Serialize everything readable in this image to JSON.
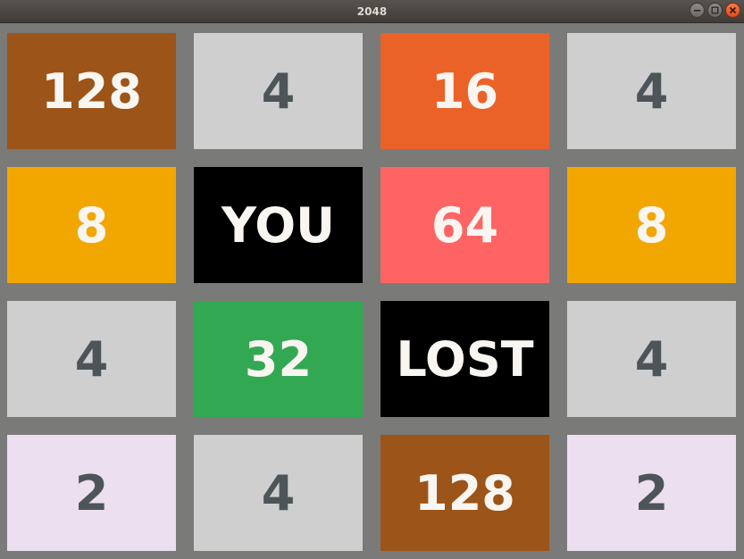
{
  "window": {
    "title": "2048",
    "controls": [
      "minimize-icon",
      "maximize-icon",
      "close-icon"
    ]
  },
  "colors": {
    "background": "#7a7a78",
    "dark_text": "#4d5558",
    "light_text": "#f9f6f2",
    "t2": "#ebdff0",
    "t4": "#cfcfcf",
    "t8": "#f2a700",
    "t16": "#eb6228",
    "t32": "#33a852",
    "t64": "#ff6464",
    "t128": "#9c5418",
    "message": "#000000"
  },
  "board": {
    "rows": [
      [
        {
          "label": "128",
          "kind": "t128"
        },
        {
          "label": "4",
          "kind": "t4"
        },
        {
          "label": "16",
          "kind": "t16"
        },
        {
          "label": "4",
          "kind": "t4"
        }
      ],
      [
        {
          "label": "8",
          "kind": "t8"
        },
        {
          "label": "YOU",
          "kind": "message"
        },
        {
          "label": "64",
          "kind": "t64"
        },
        {
          "label": "8",
          "kind": "t8"
        }
      ],
      [
        {
          "label": "4",
          "kind": "t4"
        },
        {
          "label": "32",
          "kind": "t32"
        },
        {
          "label": "LOST",
          "kind": "message"
        },
        {
          "label": "4",
          "kind": "t4"
        }
      ],
      [
        {
          "label": "2",
          "kind": "t2"
        },
        {
          "label": "4",
          "kind": "t4"
        },
        {
          "label": "128",
          "kind": "t128"
        },
        {
          "label": "2",
          "kind": "t2"
        }
      ]
    ]
  }
}
